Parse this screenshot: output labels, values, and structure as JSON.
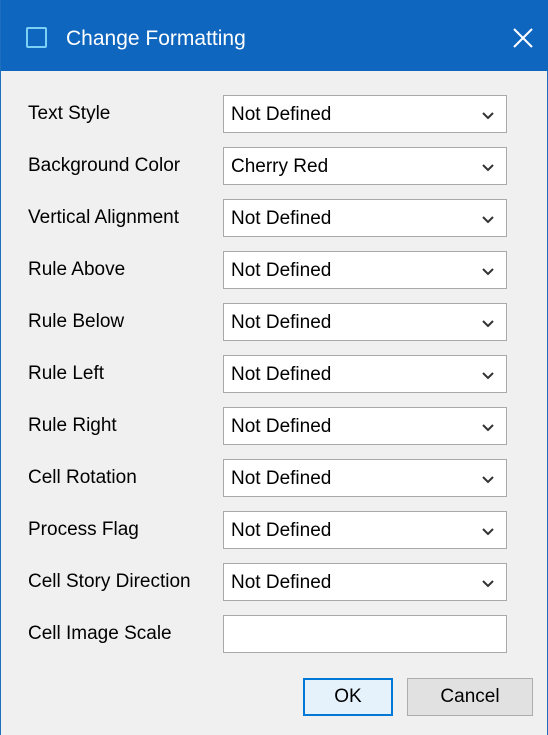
{
  "window": {
    "title": "Change Formatting"
  },
  "form": {
    "fields": [
      {
        "label": "Text Style",
        "value": "Not Defined"
      },
      {
        "label": "Background Color",
        "value": "Cherry Red"
      },
      {
        "label": "Vertical Alignment",
        "value": "Not Defined"
      },
      {
        "label": "Rule Above",
        "value": "Not Defined"
      },
      {
        "label": "Rule Below",
        "value": "Not Defined"
      },
      {
        "label": "Rule Left",
        "value": "Not Defined"
      },
      {
        "label": "Rule Right",
        "value": "Not Defined"
      },
      {
        "label": "Cell Rotation",
        "value": "Not Defined"
      },
      {
        "label": "Process Flag",
        "value": "Not Defined"
      },
      {
        "label": "Cell Story Direction",
        "value": "Not Defined"
      }
    ],
    "image_scale": {
      "label": "Cell Image Scale",
      "value": ""
    }
  },
  "buttons": {
    "ok_label": "OK",
    "cancel_label": "Cancel"
  },
  "icons": {
    "app": "window-icon",
    "close": "close-icon",
    "dropdown": "chevron-down-icon"
  },
  "colors": {
    "titlebar": "#0f66bf",
    "accent": "#0078d7"
  }
}
